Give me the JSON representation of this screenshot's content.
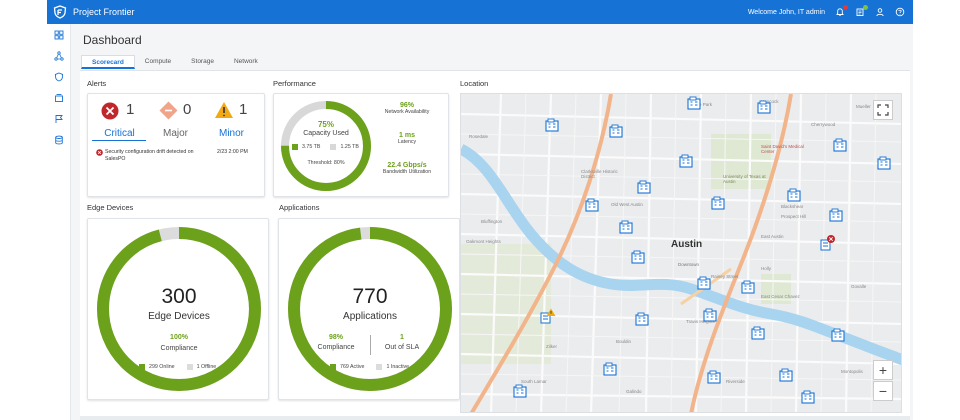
{
  "app": {
    "title": "Project Frontier",
    "welcome": "Welcome John, IT admin"
  },
  "colors": {
    "brand": "#1672d4",
    "green": "#6ca11b",
    "critical": "#c0272d",
    "major": "#f0a58a",
    "minor": "#f1a916"
  },
  "sidebar": {
    "items": [
      "dashboard-icon",
      "network-icon",
      "shield-icon",
      "layers-icon",
      "flag-icon",
      "database-icon"
    ]
  },
  "page": {
    "title": "Dashboard"
  },
  "tabs": [
    {
      "label": "Scorecard",
      "active": true
    },
    {
      "label": "Compute"
    },
    {
      "label": "Storage"
    },
    {
      "label": "Network"
    }
  ],
  "alerts": {
    "section": "Alerts",
    "critical": {
      "count": "1",
      "label": "Critical"
    },
    "major": {
      "count": "0",
      "label": "Major"
    },
    "minor": {
      "count": "1",
      "label": "Minor"
    },
    "item": {
      "message": "Security configuration drift detected on SalesPO",
      "time": "2/23 2:00 PM"
    }
  },
  "performance": {
    "section": "Performance",
    "capacity_pct": "75%",
    "capacity_label": "Capacity Used",
    "capacity_fraction": 0.75,
    "used": "3.75 TB",
    "free": "1.25 TB",
    "threshold": "Threshold: 80%",
    "availability_value": "96%",
    "availability_label": "Network Availability",
    "latency_value": "1 ms",
    "latency_label": "Latency",
    "bandwidth_value": "22.4 Gbps/s",
    "bandwidth_label": "Bandwidth Utilization"
  },
  "edge": {
    "section": "Edge Devices",
    "count": "300",
    "label": "Edge Devices",
    "compliance_value": "100%",
    "compliance_label": "Compliance",
    "online": "299 Online",
    "offline": "1 Offline",
    "fraction": 0.96
  },
  "apps": {
    "section": "Applications",
    "count": "770",
    "label": "Applications",
    "compliance_value": "98%",
    "compliance_label": "Compliance",
    "sla_value": "1",
    "sla_label": "Out of SLA",
    "active": "769 Active",
    "inactive": "1 Inactive",
    "fraction": 0.98
  },
  "location": {
    "section": "Location",
    "city": "Austin",
    "places": [
      "Downtown",
      "Hancock",
      "Hyde Park",
      "Cherrywood",
      "Mueller",
      "Clarksville Historic District",
      "Old West Austin",
      "Bluffington",
      "Rosedale",
      "Oakmont Heights",
      "Zilker",
      "Bouldin",
      "Travis Heights",
      "East Cesar Chavez",
      "Holly",
      "Riverside",
      "Montopolis",
      "Blackshear",
      "Prospect Hill",
      "Saint David's Medical Center",
      "University of Texas at Austin",
      "East Austin",
      "Rainey Street",
      "South Lamar",
      "Galindo",
      "Govalle"
    ],
    "zoom_in": "+",
    "zoom_out": "−"
  }
}
